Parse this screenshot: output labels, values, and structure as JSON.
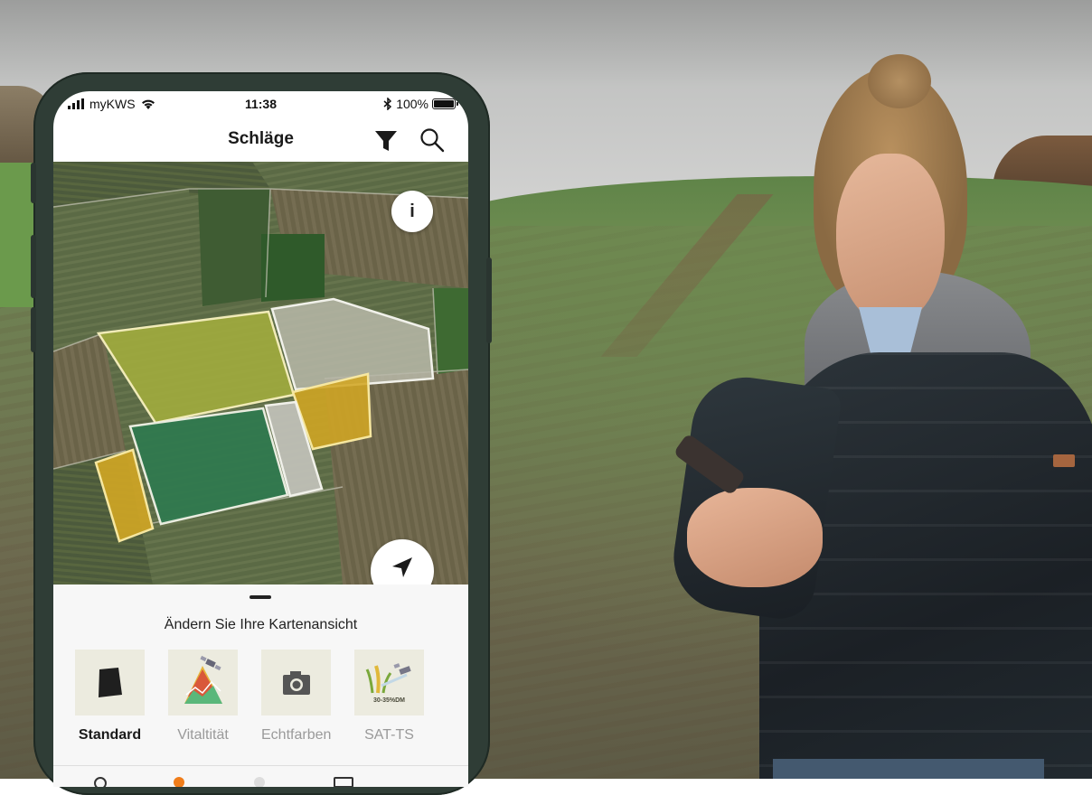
{
  "status_bar": {
    "carrier": "myKWS",
    "time": "11:38",
    "battery": "100%"
  },
  "nav": {
    "title": "Schläge"
  },
  "icons": {
    "filter": "filter-icon",
    "search": "search-icon",
    "info": "info-icon",
    "locate": "location-arrow-icon",
    "bluetooth": "bluetooth-icon"
  },
  "map": {
    "info_label": "i"
  },
  "sheet": {
    "title": "Ändern Sie Ihre Kartenansicht",
    "views": [
      {
        "label": "Standard",
        "icon": "field-shape-icon",
        "active": true
      },
      {
        "label": "Vitaltität",
        "icon": "vitality-satellite-icon",
        "active": false
      },
      {
        "label": "Echtfarben",
        "icon": "camera-icon",
        "active": false
      },
      {
        "label": "SAT-TS",
        "icon": "corn-satellite-icon",
        "active": false,
        "badge": "30-35%DM"
      }
    ]
  },
  "colors": {
    "accent": "#f07d1a",
    "phone_frame": "#2f3d36",
    "field_yellow": "#d1a623",
    "field_lime": "#a3ad3e",
    "field_green": "#2d7a4f"
  }
}
